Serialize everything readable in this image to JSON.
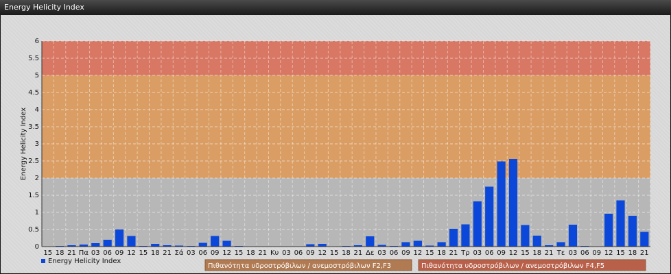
{
  "window_title": "Energy Helicity Index",
  "chart_data": {
    "type": "bar",
    "ylabel": "Energy Helicity Index",
    "ylim": [
      0,
      6
    ],
    "yticks": [
      "0",
      "0.5",
      "1",
      "1.5",
      "2",
      "2.5",
      "3",
      "3.5",
      "4",
      "4.5",
      "5",
      "5.5",
      "6"
    ],
    "categories": [
      "15",
      "18",
      "21",
      "Πα",
      "03",
      "06",
      "09",
      "12",
      "15",
      "18",
      "21",
      "Σά",
      "03",
      "06",
      "09",
      "12",
      "15",
      "18",
      "21",
      "Κυ",
      "03",
      "06",
      "09",
      "12",
      "15",
      "18",
      "21",
      "Δε",
      "03",
      "06",
      "09",
      "12",
      "15",
      "18",
      "21",
      "Τρ",
      "03",
      "06",
      "09",
      "12",
      "15",
      "18",
      "21",
      "Τε",
      "03",
      "06",
      "09",
      "12",
      "15",
      "18",
      "21"
    ],
    "series": [
      {
        "name": "Energy Helicity Index",
        "color": "#0b47d8",
        "values": [
          0.01,
          0.02,
          0.04,
          0.06,
          0.1,
          0.2,
          0.5,
          0.31,
          0.02,
          0.08,
          0.04,
          0.03,
          0.02,
          0.11,
          0.31,
          0.17,
          0.02,
          0.01,
          0.01,
          0.01,
          0.01,
          0.01,
          0.07,
          0.08,
          0.01,
          0.02,
          0.04,
          0.3,
          0.05,
          0.02,
          0.13,
          0.17,
          0.03,
          0.13,
          0.52,
          0.65,
          1.32,
          1.75,
          2.49,
          2.56,
          0.63,
          0.32,
          0.04,
          0.13,
          0.64,
          0.02,
          0.01,
          0.96,
          1.35,
          0.9,
          0.43
        ]
      }
    ],
    "ranges": [
      {
        "from": 2,
        "to": 5,
        "color": "#e09a57",
        "label": "Πιθανότητα υδροστρόβιλων / ανεμοστρόβιλων F2,F3"
      },
      {
        "from": 5,
        "to": 6,
        "color": "#de6c55",
        "label": "Πιθανότητα υδροστρόβιλων / ανεμοστρόβιλων F4,F5"
      }
    ],
    "legend_position": "bottom",
    "grid": true
  }
}
